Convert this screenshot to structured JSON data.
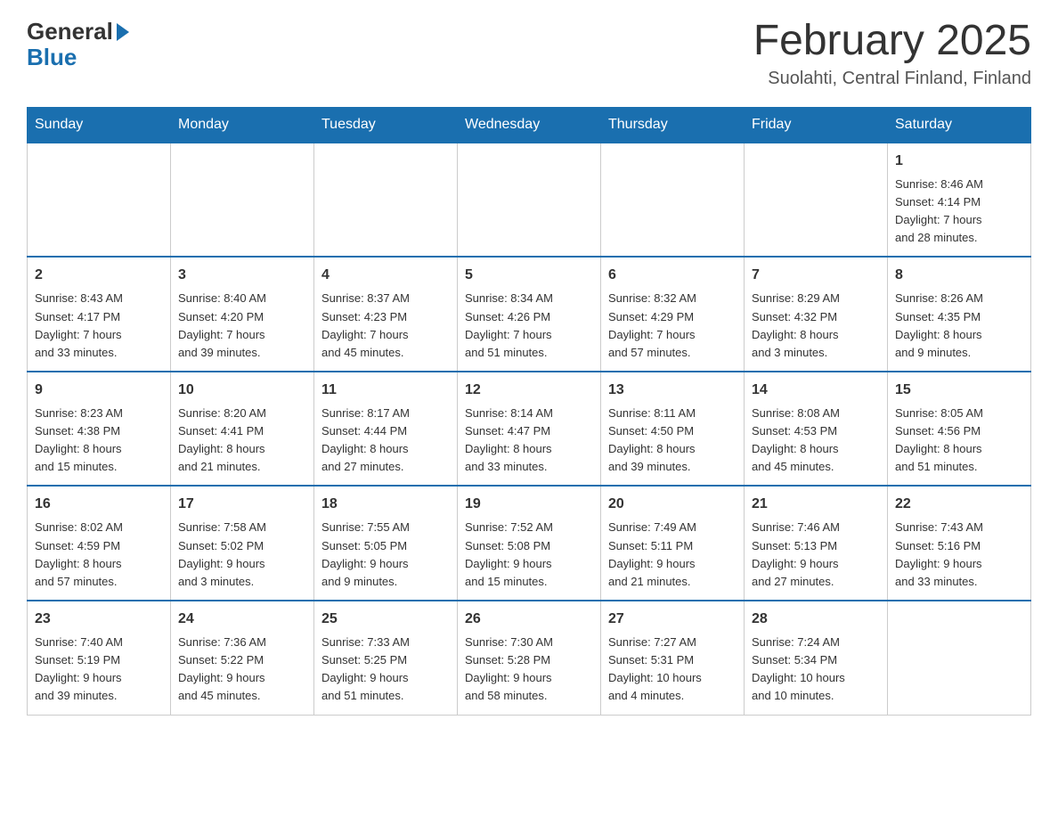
{
  "header": {
    "month_title": "February 2025",
    "location": "Suolahti, Central Finland, Finland"
  },
  "weekdays": [
    "Sunday",
    "Monday",
    "Tuesday",
    "Wednesday",
    "Thursday",
    "Friday",
    "Saturday"
  ],
  "weeks": [
    [
      {
        "day": "",
        "info": ""
      },
      {
        "day": "",
        "info": ""
      },
      {
        "day": "",
        "info": ""
      },
      {
        "day": "",
        "info": ""
      },
      {
        "day": "",
        "info": ""
      },
      {
        "day": "",
        "info": ""
      },
      {
        "day": "1",
        "info": "Sunrise: 8:46 AM\nSunset: 4:14 PM\nDaylight: 7 hours\nand 28 minutes."
      }
    ],
    [
      {
        "day": "2",
        "info": "Sunrise: 8:43 AM\nSunset: 4:17 PM\nDaylight: 7 hours\nand 33 minutes."
      },
      {
        "day": "3",
        "info": "Sunrise: 8:40 AM\nSunset: 4:20 PM\nDaylight: 7 hours\nand 39 minutes."
      },
      {
        "day": "4",
        "info": "Sunrise: 8:37 AM\nSunset: 4:23 PM\nDaylight: 7 hours\nand 45 minutes."
      },
      {
        "day": "5",
        "info": "Sunrise: 8:34 AM\nSunset: 4:26 PM\nDaylight: 7 hours\nand 51 minutes."
      },
      {
        "day": "6",
        "info": "Sunrise: 8:32 AM\nSunset: 4:29 PM\nDaylight: 7 hours\nand 57 minutes."
      },
      {
        "day": "7",
        "info": "Sunrise: 8:29 AM\nSunset: 4:32 PM\nDaylight: 8 hours\nand 3 minutes."
      },
      {
        "day": "8",
        "info": "Sunrise: 8:26 AM\nSunset: 4:35 PM\nDaylight: 8 hours\nand 9 minutes."
      }
    ],
    [
      {
        "day": "9",
        "info": "Sunrise: 8:23 AM\nSunset: 4:38 PM\nDaylight: 8 hours\nand 15 minutes."
      },
      {
        "day": "10",
        "info": "Sunrise: 8:20 AM\nSunset: 4:41 PM\nDaylight: 8 hours\nand 21 minutes."
      },
      {
        "day": "11",
        "info": "Sunrise: 8:17 AM\nSunset: 4:44 PM\nDaylight: 8 hours\nand 27 minutes."
      },
      {
        "day": "12",
        "info": "Sunrise: 8:14 AM\nSunset: 4:47 PM\nDaylight: 8 hours\nand 33 minutes."
      },
      {
        "day": "13",
        "info": "Sunrise: 8:11 AM\nSunset: 4:50 PM\nDaylight: 8 hours\nand 39 minutes."
      },
      {
        "day": "14",
        "info": "Sunrise: 8:08 AM\nSunset: 4:53 PM\nDaylight: 8 hours\nand 45 minutes."
      },
      {
        "day": "15",
        "info": "Sunrise: 8:05 AM\nSunset: 4:56 PM\nDaylight: 8 hours\nand 51 minutes."
      }
    ],
    [
      {
        "day": "16",
        "info": "Sunrise: 8:02 AM\nSunset: 4:59 PM\nDaylight: 8 hours\nand 57 minutes."
      },
      {
        "day": "17",
        "info": "Sunrise: 7:58 AM\nSunset: 5:02 PM\nDaylight: 9 hours\nand 3 minutes."
      },
      {
        "day": "18",
        "info": "Sunrise: 7:55 AM\nSunset: 5:05 PM\nDaylight: 9 hours\nand 9 minutes."
      },
      {
        "day": "19",
        "info": "Sunrise: 7:52 AM\nSunset: 5:08 PM\nDaylight: 9 hours\nand 15 minutes."
      },
      {
        "day": "20",
        "info": "Sunrise: 7:49 AM\nSunset: 5:11 PM\nDaylight: 9 hours\nand 21 minutes."
      },
      {
        "day": "21",
        "info": "Sunrise: 7:46 AM\nSunset: 5:13 PM\nDaylight: 9 hours\nand 27 minutes."
      },
      {
        "day": "22",
        "info": "Sunrise: 7:43 AM\nSunset: 5:16 PM\nDaylight: 9 hours\nand 33 minutes."
      }
    ],
    [
      {
        "day": "23",
        "info": "Sunrise: 7:40 AM\nSunset: 5:19 PM\nDaylight: 9 hours\nand 39 minutes."
      },
      {
        "day": "24",
        "info": "Sunrise: 7:36 AM\nSunset: 5:22 PM\nDaylight: 9 hours\nand 45 minutes."
      },
      {
        "day": "25",
        "info": "Sunrise: 7:33 AM\nSunset: 5:25 PM\nDaylight: 9 hours\nand 51 minutes."
      },
      {
        "day": "26",
        "info": "Sunrise: 7:30 AM\nSunset: 5:28 PM\nDaylight: 9 hours\nand 58 minutes."
      },
      {
        "day": "27",
        "info": "Sunrise: 7:27 AM\nSunset: 5:31 PM\nDaylight: 10 hours\nand 4 minutes."
      },
      {
        "day": "28",
        "info": "Sunrise: 7:24 AM\nSunset: 5:34 PM\nDaylight: 10 hours\nand 10 minutes."
      },
      {
        "day": "",
        "info": ""
      }
    ]
  ]
}
